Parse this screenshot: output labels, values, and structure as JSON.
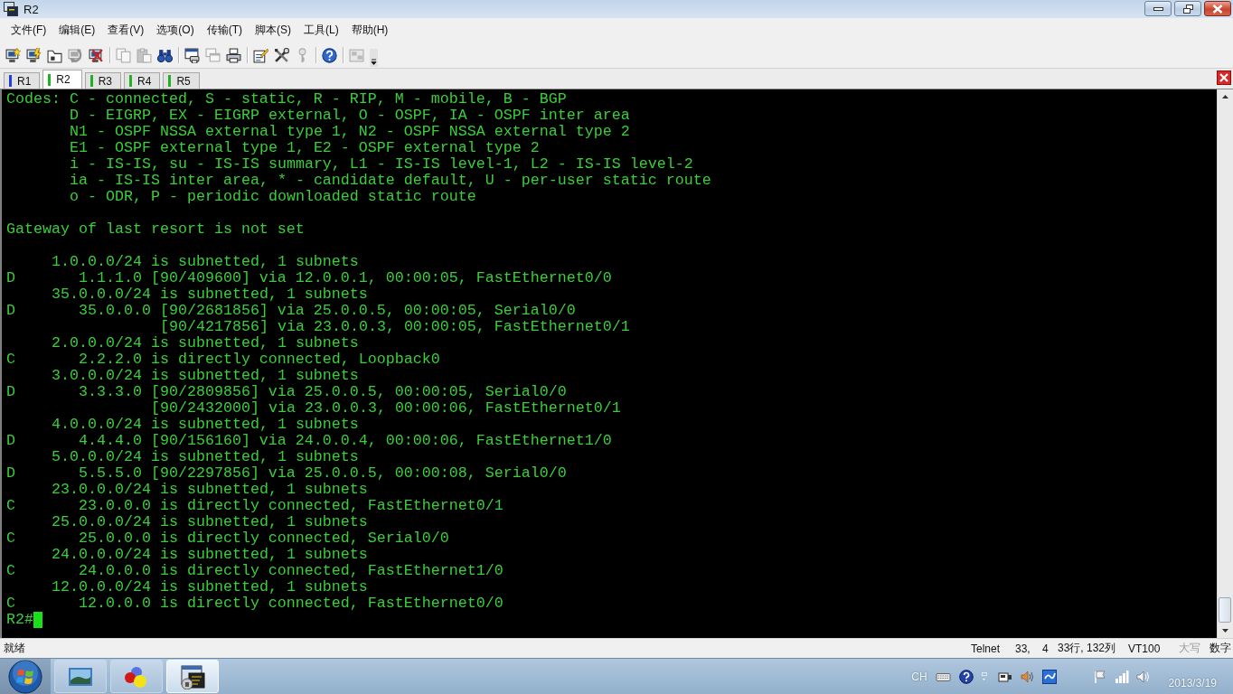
{
  "window": {
    "title": "R2"
  },
  "menu": [
    "文件(F)",
    "编辑(E)",
    "查看(V)",
    "选项(O)",
    "传输(T)",
    "脚本(S)",
    "工具(L)",
    "帮助(H)"
  ],
  "toolbar": [
    {
      "kind": "connect",
      "disabled": false
    },
    {
      "kind": "quick-connect",
      "disabled": false
    },
    {
      "kind": "connect-tab",
      "disabled": false
    },
    {
      "kind": "reconnect",
      "disabled": true
    },
    {
      "kind": "disconnect",
      "disabled": false
    },
    {
      "kind": "separator"
    },
    {
      "kind": "copy",
      "disabled": true
    },
    {
      "kind": "paste",
      "disabled": true
    },
    {
      "kind": "find",
      "disabled": false
    },
    {
      "kind": "separator"
    },
    {
      "kind": "print-screen",
      "disabled": false
    },
    {
      "kind": "print-selection",
      "disabled": true
    },
    {
      "kind": "print",
      "disabled": false
    },
    {
      "kind": "separator"
    },
    {
      "kind": "session-options",
      "disabled": false
    },
    {
      "kind": "global-options",
      "disabled": false
    },
    {
      "kind": "keys",
      "disabled": true
    },
    {
      "kind": "separator"
    },
    {
      "kind": "help",
      "disabled": false
    },
    {
      "kind": "separator"
    },
    {
      "kind": "tile",
      "disabled": true
    },
    {
      "kind": "overflow"
    }
  ],
  "tabs": [
    {
      "label": "R1",
      "color": "#1f3fe0",
      "selected": false
    },
    {
      "label": "R2",
      "color": "#22b022",
      "selected": true
    },
    {
      "label": "R3",
      "color": "#22b022",
      "selected": false
    },
    {
      "label": "R4",
      "color": "#22b022",
      "selected": false
    },
    {
      "label": "R5",
      "color": "#22b022",
      "selected": false
    }
  ],
  "terminal": {
    "blocks": [
      [
        "Codes: C - connected, S - static, R - RIP, M - mobile, B - BGP",
        "       D - EIGRP, EX - EIGRP external, O - OSPF, IA - OSPF inter area",
        "       N1 - OSPF NSSA external type 1, N2 - OSPF NSSA external type 2",
        "       E1 - OSPF external type 1, E2 - OSPF external type 2",
        "       i - IS-IS, su - IS-IS summary, L1 - IS-IS level-1, L2 - IS-IS level-2",
        "       ia - IS-IS inter area, * - candidate default, U - per-user static route",
        "       o - ODR, P - periodic downloaded static route"
      ],
      [
        "Gateway of last resort is not set"
      ],
      [
        "     1.0.0.0/24 is subnetted, 1 subnets",
        "D       1.1.1.0 [90/409600] via 12.0.0.1, 00:00:05, FastEthernet0/0",
        "     35.0.0.0/24 is subnetted, 1 subnets",
        "D       35.0.0.0 [90/2681856] via 25.0.0.5, 00:00:05, Serial0/0",
        "                 [90/4217856] via 23.0.0.3, 00:00:05, FastEthernet0/1",
        "     2.0.0.0/24 is subnetted, 1 subnets",
        "C       2.2.2.0 is directly connected, Loopback0",
        "     3.0.0.0/24 is subnetted, 1 subnets",
        "D       3.3.3.0 [90/2809856] via 25.0.0.5, 00:00:05, Serial0/0",
        "                [90/2432000] via 23.0.0.3, 00:00:06, FastEthernet0/1",
        "     4.0.0.0/24 is subnetted, 1 subnets",
        "D       4.4.4.0 [90/156160] via 24.0.0.4, 00:00:06, FastEthernet1/0",
        "     5.0.0.0/24 is subnetted, 1 subnets",
        "D       5.5.5.0 [90/2297856] via 25.0.0.5, 00:00:08, Serial0/0",
        "     23.0.0.0/24 is subnetted, 1 subnets",
        "C       23.0.0.0 is directly connected, FastEthernet0/1",
        "     25.0.0.0/24 is subnetted, 1 subnets",
        "C       25.0.0.0 is directly connected, Serial0/0",
        "     24.0.0.0/24 is subnetted, 1 subnets",
        "C       24.0.0.0 is directly connected, FastEthernet1/0",
        "     12.0.0.0/24 is subnetted, 1 subnets",
        "C       12.0.0.0 is directly connected, FastEthernet0/0"
      ]
    ],
    "prompt": "R2#"
  },
  "status_bar": {
    "message": "就绪",
    "protocol": "Telnet",
    "row": "33,",
    "column": "4",
    "size": "33行, 132列",
    "emulation": "VT100",
    "indicators": [
      {
        "label": "大写",
        "on": false
      },
      {
        "label": "数字",
        "on": true
      }
    ]
  },
  "taskbar": {
    "apps": [
      {
        "kind": "viewer",
        "selected": false
      },
      {
        "kind": "balls",
        "selected": false
      },
      {
        "kind": "terminal",
        "selected": true
      }
    ],
    "language": "CH",
    "date": "2013/3/19"
  }
}
